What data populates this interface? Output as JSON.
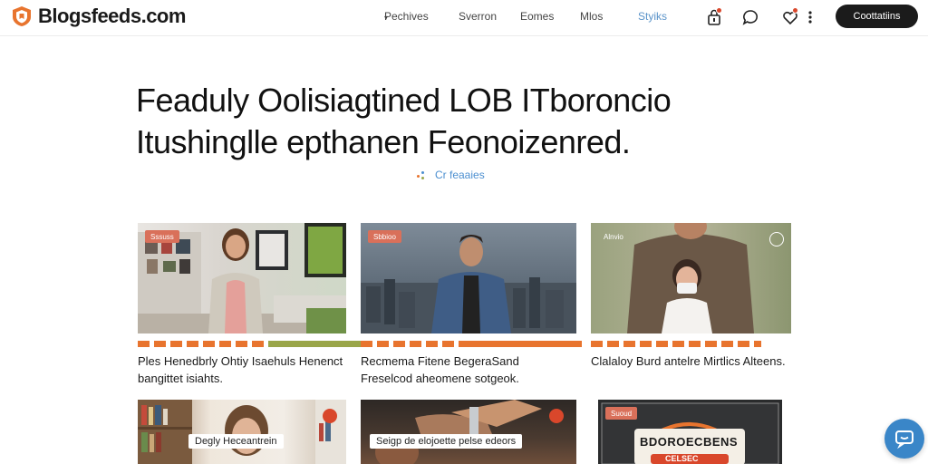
{
  "brand": {
    "name": "Blogsfeeds.com",
    "accent": "#e8742e"
  },
  "nav": {
    "items": [
      {
        "label": "Pechives",
        "has_dropdown": true,
        "active": false
      },
      {
        "label": "Sverron",
        "active": false
      },
      {
        "label": "Eomes",
        "active": false
      },
      {
        "label": "Mlos",
        "active": false
      },
      {
        "label": "Styiks",
        "active": true
      }
    ]
  },
  "header_icons": [
    "lock-icon",
    "chat-bubble-icon",
    "heart-notification-icon",
    "more-vertical-icon"
  ],
  "cta": {
    "label": "Coottatiins"
  },
  "hero": {
    "title_line1": "Feaduly Oolisiagtined LOB ITboroncio",
    "title_line2": "Itushinglle epthanen Feonoizenred.",
    "filter_label": "Cr feaaies"
  },
  "cards": [
    {
      "tag": "Sssuss",
      "title": "Ples  Henedbrly  Ohtiy  Isaehuls Henenct  bangittet  isiahts."
    },
    {
      "tag": "Sbbioo",
      "title": "Recmema  Fitene  BegeraSand Freselcod  aheomene  sotgeok."
    },
    {
      "tag": "Alnvio",
      "title": "Clalaloy  Burd  antelre  Mirtlics Alteens."
    },
    {
      "overlay": "Degly  Heceantrein"
    },
    {
      "overlay": "Seigp  de  elojoette  pelse  edeors"
    },
    {
      "tag": "Suoud",
      "overlay": "BDOROECBENS",
      "overlay2": "CELSEC"
    }
  ]
}
